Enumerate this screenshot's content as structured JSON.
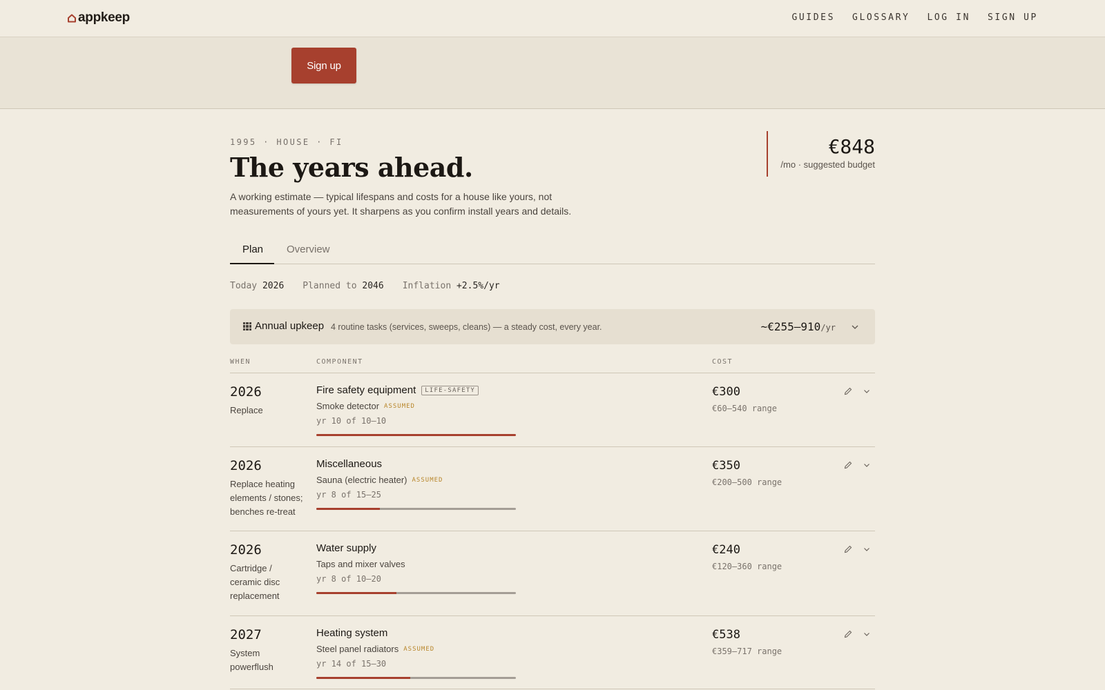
{
  "brand": {
    "name": "appkeep"
  },
  "nav": {
    "links": [
      "GUIDES",
      "GLOSSARY",
      "LOG IN",
      "SIGN UP"
    ]
  },
  "banner": {
    "cta_label": "Sign up"
  },
  "header": {
    "meta": "1995 · HOUSE · FI",
    "title": "The years ahead.",
    "subtitle": "A working estimate — typical lifespans and costs for a house like yours, not measurements of yours yet. It sharpens as you confirm install years and details.",
    "budget_amount": "€848",
    "budget_label": "/mo · suggested budget"
  },
  "tabs": [
    {
      "label": "Plan",
      "active": true
    },
    {
      "label": "Overview",
      "active": false
    }
  ],
  "stats": {
    "today_label": "Today",
    "today_value": "2026",
    "planned_label": "Planned to",
    "planned_value": "2046",
    "inflation_label": "Inflation",
    "inflation_value": "+2.5%/yr"
  },
  "upkeep": {
    "title": "Annual upkeep",
    "description": "4 routine tasks (services, sweeps, cleans) — a steady cost, every year.",
    "cost": "~€255–910",
    "unit": "/yr"
  },
  "table": {
    "headers": {
      "when": "WHEN",
      "component": "COMPONENT",
      "cost": "COST"
    },
    "rows": [
      {
        "year": "2026",
        "action": "Replace",
        "component": "Fire safety equipment",
        "badge": "LIFE-SAFETY",
        "sub": "Smoke detector",
        "assumed": "ASSUMED",
        "age": "yr 10 of 10–10",
        "progress": 1.0,
        "cost": "€300",
        "range": "€60–540 range"
      },
      {
        "year": "2026",
        "action": "Replace heating elements / stones; benches re-treat",
        "component": "Miscellaneous",
        "badge": "",
        "sub": "Sauna (electric heater)",
        "assumed": "ASSUMED",
        "age": "yr 8 of 15–25",
        "progress": 0.32,
        "cost": "€350",
        "range": "€200–500 range"
      },
      {
        "year": "2026",
        "action": "Cartridge / ceramic disc replacement",
        "component": "Water supply",
        "badge": "",
        "sub": "Taps and mixer valves",
        "assumed": "",
        "age": "yr 8 of 10–20",
        "progress": 0.4,
        "cost": "€240",
        "range": "€120–360 range"
      },
      {
        "year": "2027",
        "action": "System powerflush",
        "component": "Heating system",
        "badge": "",
        "sub": "Steel panel radiators",
        "assumed": "ASSUMED",
        "age": "yr 14 of 15–30",
        "progress": 0.47,
        "cost": "€538",
        "range": "€359–717 range"
      }
    ]
  },
  "colors": {
    "accent": "#a7402e",
    "background": "#f1ece1",
    "assumed": "#b8862b"
  },
  "icons": {
    "logo": "house-icon",
    "upkeep": "grid-icon",
    "edit": "pencil-icon",
    "expand": "chevron-down-icon"
  }
}
